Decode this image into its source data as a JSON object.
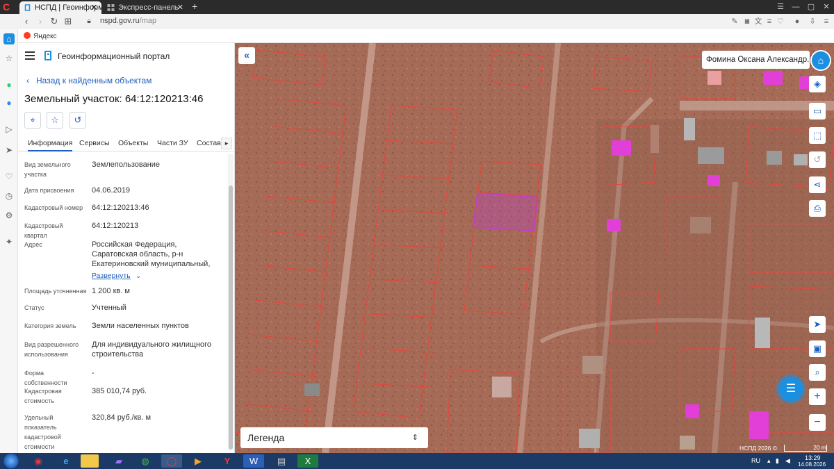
{
  "browser": {
    "tabs": [
      {
        "label": "НСПД | Геоинформацион",
        "active": true
      },
      {
        "label": "Экспресс-панель",
        "active": false
      }
    ],
    "url_host": "nspd.gov.ru",
    "url_path": "/map",
    "bookmark": "Яндекс"
  },
  "panel": {
    "portal_title": "Геоинформационный портал",
    "back_label": "Назад к найденным объектам",
    "object_title": "Земельный участок: 64:12:120213:46",
    "tabs": [
      "Информация",
      "Сервисы",
      "Объекты",
      "Части ЗУ",
      "Состав"
    ],
    "rows": [
      {
        "label": "Вид земельного участка",
        "value": "Землепользование"
      },
      {
        "label": "Дата присвоения",
        "value": "04.06.2019"
      },
      {
        "label": "Кадастровый номер",
        "value": "64:12:120213:46"
      },
      {
        "label": "Кадастровый квартал",
        "value": "64:12:120213"
      },
      {
        "label": "Адрес",
        "value": "Российская Федерация, Саратовская область, р-н Екатериновский муниципальный,",
        "expand": "Развернуть"
      },
      {
        "label": "Площадь уточненная",
        "value": "1 200 кв. м"
      },
      {
        "label": "Статус",
        "value": "Учтенный"
      },
      {
        "label": "Категория земель",
        "value": "Земли населенных пунктов"
      },
      {
        "label": "Вид разрешенного использования",
        "value": "Для индивидуального жилищного строительства"
      },
      {
        "label": "Форма собственности",
        "value": "-"
      },
      {
        "label": "Кадастровая стоимость",
        "value": "385 010,74 руб."
      },
      {
        "label": "Удельный показатель кадастровой стоимости",
        "value": "320,84 руб./кв. м"
      }
    ]
  },
  "map": {
    "user_name": "Фомина Оксана Александр...",
    "legend_label": "Легенда",
    "copyright": "НСПД 2026 ©",
    "scale_label": "20 m"
  },
  "taskbar": {
    "lang": "RU",
    "time": "13:29",
    "date": "14.08.2026"
  },
  "colors": {
    "accent": "#1d5fbf",
    "parcel_line": "#e8453c",
    "selected_parcel": "#c43cd6",
    "building": "#e23fd8"
  }
}
